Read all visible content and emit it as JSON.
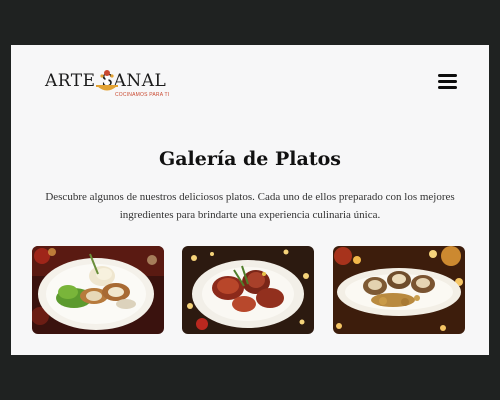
{
  "header": {
    "logo_text": "ARTE SANAL",
    "logo_tagline": "COCINAMOS PARA TI",
    "menu_icon": "hamburger-menu-icon"
  },
  "gallery": {
    "title": "Galería de Platos",
    "description": "Descubre algunos de nuestros deliciosos platos. Cada uno de ellos preparado con los mejores ingredientes para brindarte una experiencia culinaria única.",
    "photos": [
      {
        "subject": "stuffed-chicken-rolls-with-salad-and-mashed-potatoes"
      },
      {
        "subject": "glazed-meat-with-herbs-on-white-plate"
      },
      {
        "subject": "sliced-rolled-meat-with-roasted-potatoes"
      }
    ]
  },
  "colors": {
    "page_background": "#1f2221",
    "card_background": "#f7f7f8",
    "logo_accent": "#c9482f",
    "logo_gold": "#e2a233"
  }
}
